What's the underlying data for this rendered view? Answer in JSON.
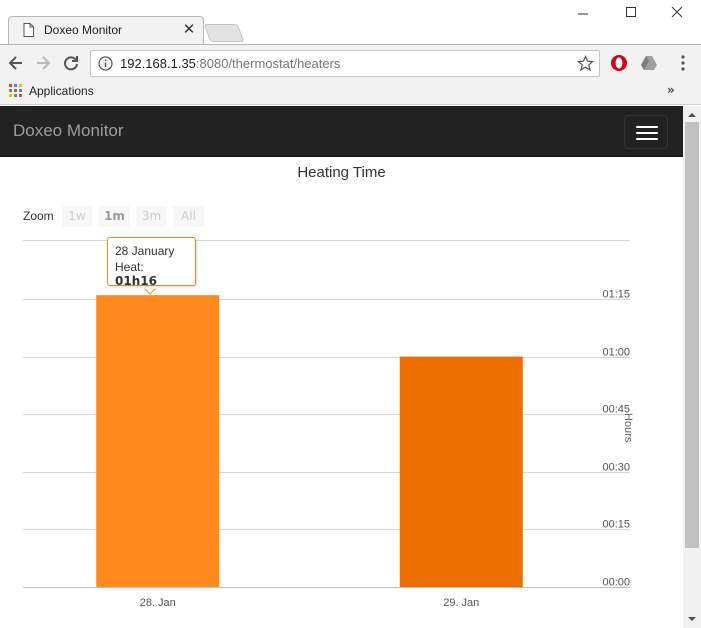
{
  "browser": {
    "tab_title": "Doxeo Monitor",
    "url_host": "192.168.1.35",
    "url_rest": ":8080/thermostat/heaters",
    "bookmark_apps": "Applications",
    "bookmark_more": "»"
  },
  "page": {
    "brand": "Doxeo Monitor"
  },
  "zoom": {
    "label": "Zoom",
    "buttons": [
      "1w",
      "1m",
      "3m",
      "All"
    ],
    "active": "1m"
  },
  "tooltip": {
    "date": "28 January",
    "label": "Heat:",
    "value": "01h16"
  },
  "chart_data": {
    "type": "bar",
    "title": "Heating Time",
    "categories": [
      "28. Jan",
      "29. Jan"
    ],
    "values": [
      76,
      60
    ],
    "value_unit": "minutes",
    "ylabel": "Hours",
    "y_ticks": [
      "00:00",
      "00:15",
      "00:30",
      "00:45",
      "01:00",
      "01:15"
    ],
    "ylim": [
      0,
      90
    ],
    "y_axis_side": "right",
    "grid": true,
    "colors": [
      "#fe8a1d",
      "#ec6d00"
    ]
  }
}
